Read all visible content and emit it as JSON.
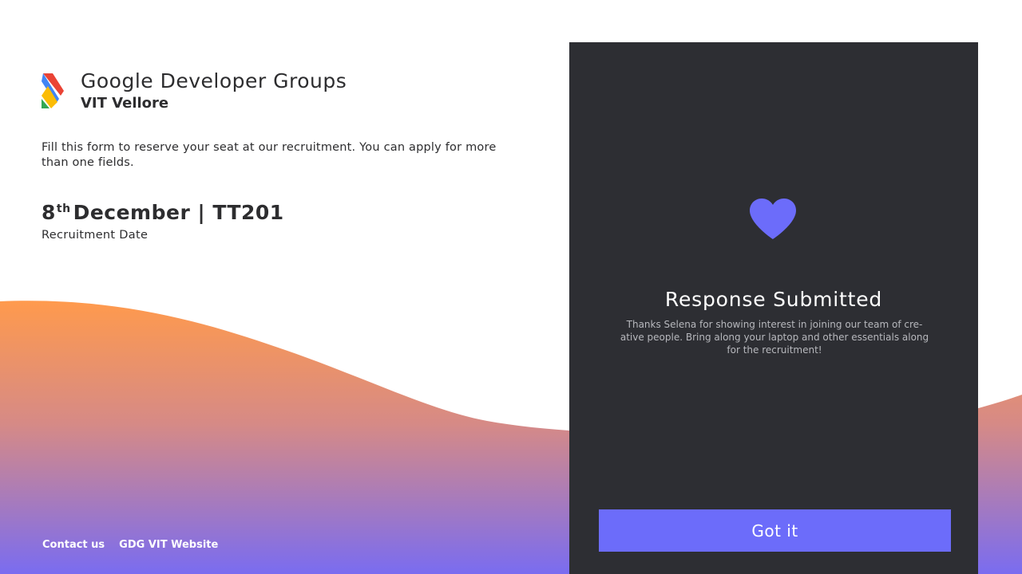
{
  "brand": {
    "title": "Google Developer Groups",
    "subtitle": "VIT Vellore",
    "logo_icon": "gdg-chevron-logo-icon"
  },
  "intro": {
    "text": "Fill this form to reserve your seat at our recruitment. You can apply for more than one fields."
  },
  "event": {
    "day": "8",
    "day_suffix": "th",
    "date_rest": "December | TT201",
    "date_label": "Recruitment Date"
  },
  "footer": {
    "links": [
      {
        "label": "Contact us"
      },
      {
        "label": "GDG VIT Website"
      }
    ]
  },
  "card": {
    "icon": "heart-icon",
    "title": "Response Submitted",
    "message": "Thanks Selena for showing interest in joining our team of cre-ative people. Bring along your laptop and other essentials along for the recruitment!",
    "button_label": "Got it"
  },
  "colors": {
    "accent": "#6c6cfa",
    "card_background": "#2d2e33",
    "wave_top": "#ff9a4d",
    "wave_bottom": "#7a6cf0",
    "text_dark": "#2d2d2f"
  }
}
